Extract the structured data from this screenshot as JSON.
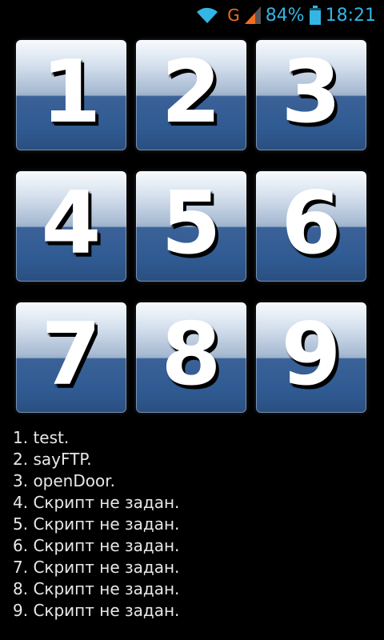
{
  "status_bar": {
    "network_type": "G",
    "battery_percent": "84%",
    "time": "18:21",
    "icons": [
      "wifi-icon",
      "signal-icon",
      "battery-icon"
    ],
    "accent_color": "#33b5e5",
    "network_color": "#f06d1e"
  },
  "keypad": {
    "keys": [
      {
        "label": "1"
      },
      {
        "label": "2"
      },
      {
        "label": "3"
      },
      {
        "label": "4"
      },
      {
        "label": "5"
      },
      {
        "label": "6"
      },
      {
        "label": "7"
      },
      {
        "label": "8"
      },
      {
        "label": "9"
      }
    ]
  },
  "scripts": [
    "1. test.",
    "2. sayFTP.",
    "3. openDoor.",
    "4. Скрипт не задан.",
    "5. Скрипт не задан.",
    "6. Скрипт не задан.",
    "7. Скрипт не задан.",
    "8. Скрипт не задан.",
    "9. Скрипт не задан."
  ]
}
